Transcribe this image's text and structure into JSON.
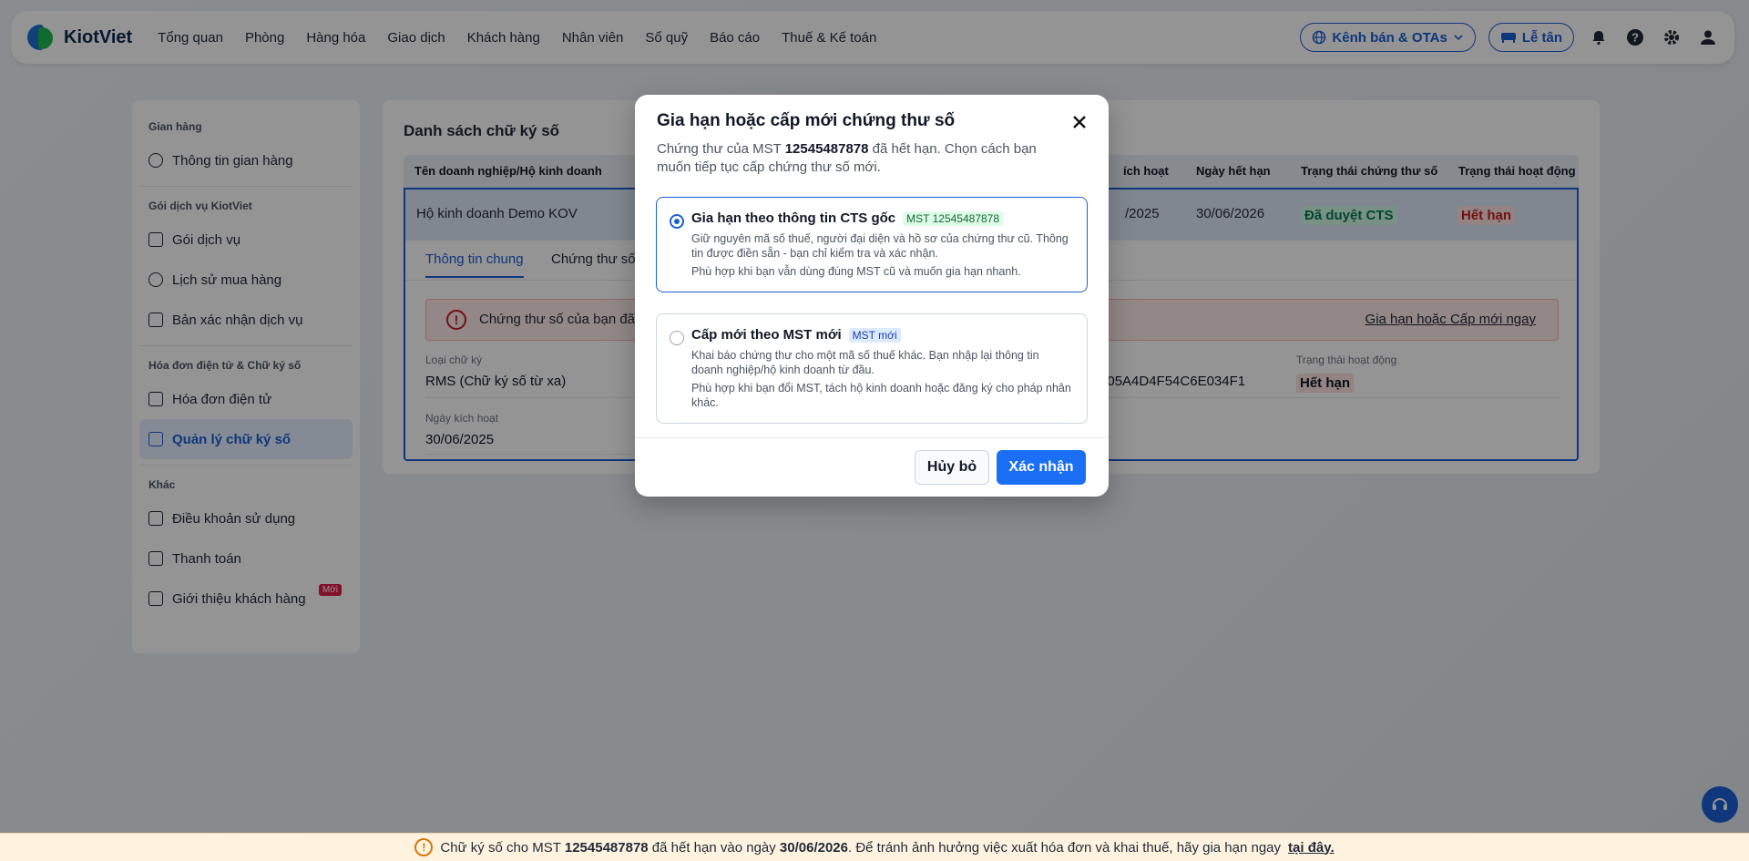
{
  "app": {
    "logo_text": "KiotViet"
  },
  "nav": [
    "Tổng quan",
    "Phòng",
    "Hàng hóa",
    "Giao dịch",
    "Khách hàng",
    "Nhân viên",
    "Sổ quỹ",
    "Báo cáo",
    "Thuế & Kế toán"
  ],
  "topright": {
    "channel_label": "Kênh bán & OTAs",
    "reception_label": "Lễ tân"
  },
  "sidebar": {
    "groups": [
      {
        "title": "Gian hàng",
        "items": [
          "Thông tin gian hàng"
        ]
      },
      {
        "title": "Gói dịch vụ KiotViet",
        "items": [
          "Gói dịch vụ",
          "Lịch sử mua hàng",
          "Bản xác nhận dịch vụ"
        ]
      },
      {
        "title": "Hóa đơn điện tử & Chữ ký số",
        "items": [
          "Hóa đơn điện tử",
          "Quản lý chữ ký số"
        ]
      },
      {
        "title": "Khác",
        "items": [
          "Điều khoản sử dụng",
          "Thanh toán",
          "Giới thiệu khách hàng"
        ]
      }
    ],
    "new_badge": "Mới"
  },
  "main": {
    "title": "Danh sách chữ ký số",
    "columns": [
      "Tên doanh nghiệp/Hộ kinh doanh",
      "ích hoạt",
      "Ngày hết hạn",
      "Trạng thái chứng thư số",
      "Trạng thái hoạt động"
    ],
    "row": {
      "name": "Hộ kinh doanh Demo KOV",
      "activated": "/2025",
      "expires": "30/06/2026",
      "cert_status": "Đã duyệt CTS",
      "active_status": "Hết hạn"
    },
    "tabs": [
      "Thông tin chung",
      "Chứng thư số"
    ],
    "alert": {
      "message": "Chứng thư số của bạn đã",
      "link": "Gia hạn hoặc Cấp mới ngay"
    },
    "fields": {
      "type_label": "Loại chữ ký",
      "type_value": "RMS (Chữ ký số từ xa)",
      "activated_label": "Ngày kích hoạt",
      "activated_value": "30/06/2025",
      "serial_value": "5E05A4D4F54C6E034F1",
      "status_label": "Trạng thái hoạt động",
      "status_value": "Hết hạn"
    }
  },
  "modal": {
    "title": "Gia hạn hoặc cấp mới chứng thư số",
    "subtitle_pre": "Chứng thư của MST ",
    "subtitle_mst": "12545487878",
    "subtitle_post": " đã hết hạn. Chọn cách bạn muốn tiếp tục cấp chứng thư số mới.",
    "option1": {
      "title": "Gia hạn theo thông tin CTS gốc",
      "tag": "MST 12545487878",
      "desc": "Giữ nguyên mã số thuế, người đại diện và hồ sơ của chứng thư cũ. Thông tin được điền sẵn - bạn chỉ kiểm tra và xác nhận.",
      "note": "Phù hợp khi bạn vẫn dùng đúng MST cũ và muốn gia hạn nhanh."
    },
    "option2": {
      "title": "Cấp mới theo MST mới",
      "tag": "MST mới",
      "desc": "Khai báo chứng thư cho một mã số thuế khác. Bạn nhập lại thông tin doanh nghiệp/hộ kinh doanh từ đầu.",
      "note": "Phù hợp khi bạn đổi MST, tách hộ kinh doanh hoặc đăng ký cho pháp nhân khác."
    },
    "cancel_label": "Hủy bỏ",
    "confirm_label": "Xác nhận"
  },
  "bottom_bar": {
    "pre": "Chữ ký số cho MST ",
    "mst": "12545487878",
    "mid": " đã hết hạn vào ngày ",
    "date": "30/06/2026",
    "post": ". Để tránh ảnh hưởng việc xuất hóa đơn và khai thuế, hãy gia hạn ngay ",
    "link": "tại đây."
  },
  "colors": {
    "accent": "#1a6ff5",
    "danger": "#c81e1e",
    "success": "#047857"
  }
}
